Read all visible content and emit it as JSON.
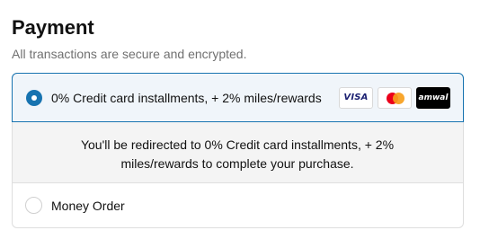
{
  "header": {
    "title": "Payment",
    "subtitle": "All transactions are secure and encrypted."
  },
  "payment_options": [
    {
      "label": "0% Credit card installments, + 2% miles/rewards",
      "selected": true,
      "card_icons": [
        "visa-icon",
        "mastercard-icon",
        "amwal-icon"
      ],
      "visa_text": "VISA",
      "amwal_text": "amwal",
      "redirect_message": "You'll be redirected to 0% Credit card installments, + 2% miles/rewards to complete your purchase."
    },
    {
      "label": "Money Order",
      "selected": false
    }
  ],
  "colors": {
    "accent": "#1773b0",
    "selected_bg": "#f0f5fa",
    "panel_bg": "#f4f4f4",
    "subtitle_text": "#707070"
  }
}
